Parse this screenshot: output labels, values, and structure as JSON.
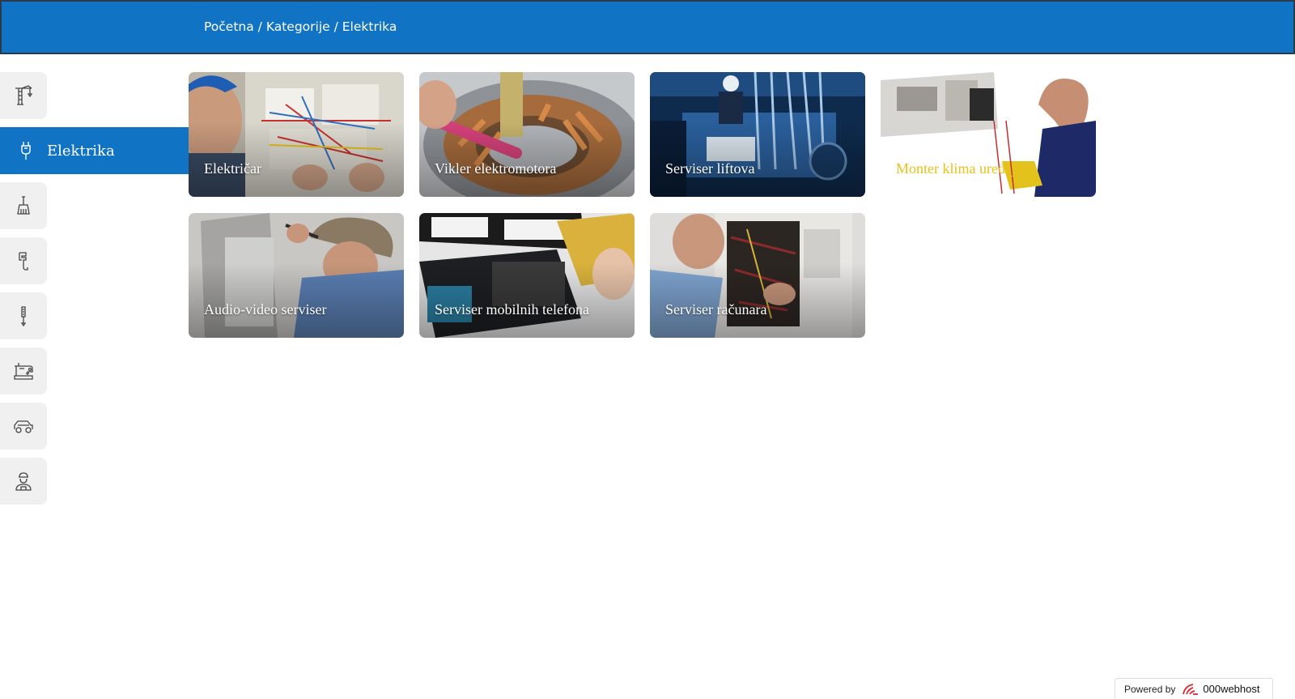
{
  "breadcrumb": {
    "home": "Početna",
    "categories": "Kategorije",
    "current": "Elektrika",
    "separator": " / "
  },
  "sidebar": {
    "items": [
      {
        "icon": "crane-icon"
      },
      {
        "icon": "electric-plug-icon",
        "label": "Elektrika"
      },
      {
        "icon": "brush-icon"
      },
      {
        "icon": "pipe-wrench-icon"
      },
      {
        "icon": "screwdriver-icon"
      },
      {
        "icon": "sewing-machine-icon"
      },
      {
        "icon": "car-icon"
      },
      {
        "icon": "worker-icon"
      }
    ]
  },
  "tiles": [
    {
      "title": "Električar"
    },
    {
      "title": "Vikler elektromotora"
    },
    {
      "title": "Serviser liftova"
    },
    {
      "title": "Monter klima uređaja"
    },
    {
      "title": "Audio-video serviser"
    },
    {
      "title": "Serviser mobilnih telefona"
    },
    {
      "title": "Serviser računara"
    }
  ],
  "footer": {
    "powered_by": "Powered by",
    "brand": "000webhost"
  },
  "colors": {
    "primary": "#1173c3",
    "sidebar_bg": "#f0f0f0",
    "highlight_text": "#e8c11a"
  }
}
